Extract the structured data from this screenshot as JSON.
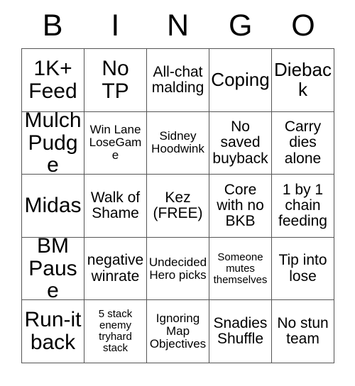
{
  "card": {
    "headers": [
      "B",
      "I",
      "N",
      "G",
      "O"
    ],
    "rows": [
      [
        {
          "text": "1K+ Feed",
          "size": "xl"
        },
        {
          "text": "No TP",
          "size": "xl"
        },
        {
          "text": "All-chat malding",
          "size": "md"
        },
        {
          "text": "Coping",
          "size": "lg"
        },
        {
          "text": "Dieback",
          "size": "lg"
        }
      ],
      [
        {
          "text": "Mulch Pudge",
          "size": "xl"
        },
        {
          "text": "Win Lane LoseGame",
          "size": "sm"
        },
        {
          "text": "Sidney Hoodwink",
          "size": "sm"
        },
        {
          "text": "No saved buyback",
          "size": "md"
        },
        {
          "text": "Carry dies alone",
          "size": "md"
        }
      ],
      [
        {
          "text": "Midas",
          "size": "xl"
        },
        {
          "text": "Walk of Shame",
          "size": "md"
        },
        {
          "text": "Kez (FREE)",
          "size": "md"
        },
        {
          "text": "Core with no BKB",
          "size": "md"
        },
        {
          "text": "1 by 1 chain feeding",
          "size": "md"
        }
      ],
      [
        {
          "text": "BM Pause",
          "size": "xl"
        },
        {
          "text": "negative winrate",
          "size": "md"
        },
        {
          "text": "Undecided Hero picks",
          "size": "sm"
        },
        {
          "text": "Someone mutes themselves",
          "size": "xs"
        },
        {
          "text": "Tip into lose",
          "size": "md"
        }
      ],
      [
        {
          "text": "Run-it back",
          "size": "xl"
        },
        {
          "text": "5 stack enemy tryhard stack",
          "size": "xs"
        },
        {
          "text": "Ignoring Map Objectives",
          "size": "sm"
        },
        {
          "text": "Snadies Shuffle",
          "size": "md"
        },
        {
          "text": "No stun team",
          "size": "md"
        }
      ]
    ]
  },
  "colors": {
    "background": "#ffffff",
    "text": "#000000",
    "grid_line": "#555555"
  }
}
